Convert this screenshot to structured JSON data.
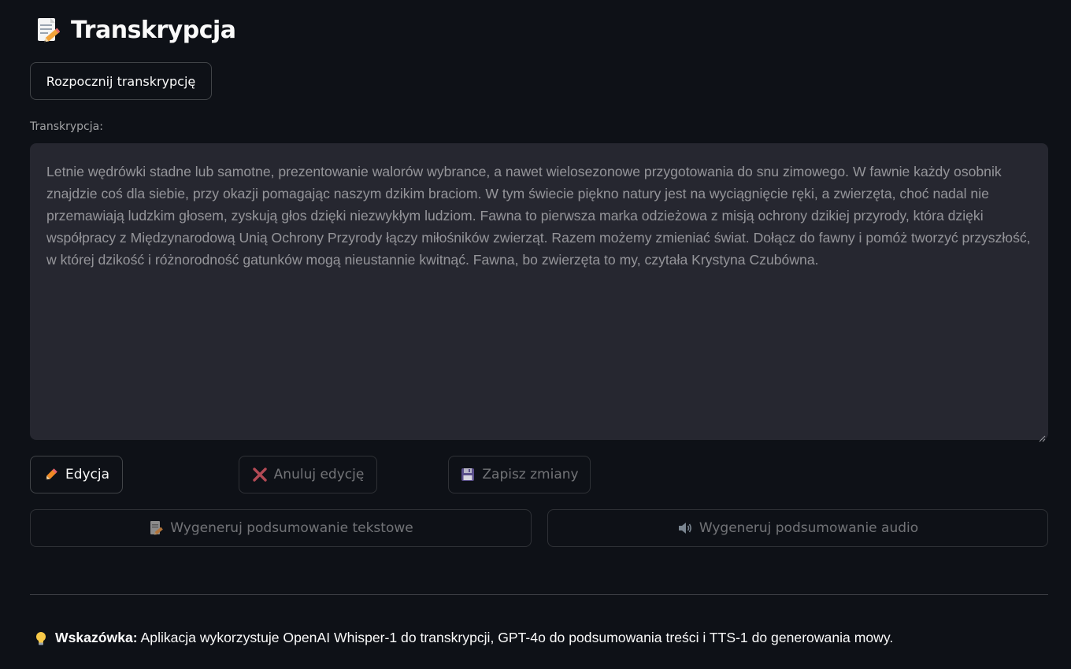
{
  "header": {
    "title": "Transkrypcja",
    "icon": "memo-pencil-icon"
  },
  "actions": {
    "start_label": "Rozpocznij transkrypcję"
  },
  "transcription": {
    "label": "Transkrypcja:",
    "text": "Letnie wędrówki stadne lub samotne, prezentowanie walorów wybrance, a nawet wielosezonowe przygotowania do snu zimowego. W fawnie każdy osobnik znajdzie coś dla siebie, przy okazji pomagając naszym dzikim braciom. W tym świecie piękno natury jest na wyciągnięcie ręki, a zwierzęta, choć nadal nie przemawiają ludzkim głosem, zyskują głos dzięki niezwykłym ludziom. Fawna to pierwsza marka odzieżowa z misją ochrony dzikiej przyrody, która dzięki współpracy z Międzynarodową Unią Ochrony Przyrody łączy miłośników zwierząt. Razem możemy zmieniać świat. Dołącz do fawny i pomóż tworzyć przyszłość, w której dzikość i różnorodność gatunków mogą nieustannie kwitnąć. Fawna, bo zwierzęta to my, czytała Krystyna Czubówna."
  },
  "edit_controls": {
    "edit_label": "Edycja",
    "edit_icon": "pencil-icon",
    "cancel_label": "Anuluj edycję",
    "cancel_icon": "cross-mark-icon",
    "save_label": "Zapisz zmiany",
    "save_icon": "floppy-disk-icon"
  },
  "summary_controls": {
    "text_summary_label": "Wygeneruj podsumowanie tekstowe",
    "text_summary_icon": "memo-icon",
    "audio_summary_label": "Wygeneruj podsumowanie audio",
    "audio_summary_icon": "speaker-icon"
  },
  "tip": {
    "icon": "light-bulb-icon",
    "bold": "Wskazówka:",
    "text": "Aplikacja wykorzystuje OpenAI Whisper-1 do transkrypcji, GPT-4o do podsumowania treści i TTS-1 do generowania mowy."
  },
  "colors": {
    "background": "#0e1117",
    "textarea_bg": "#262730",
    "text": "#fafafa"
  }
}
